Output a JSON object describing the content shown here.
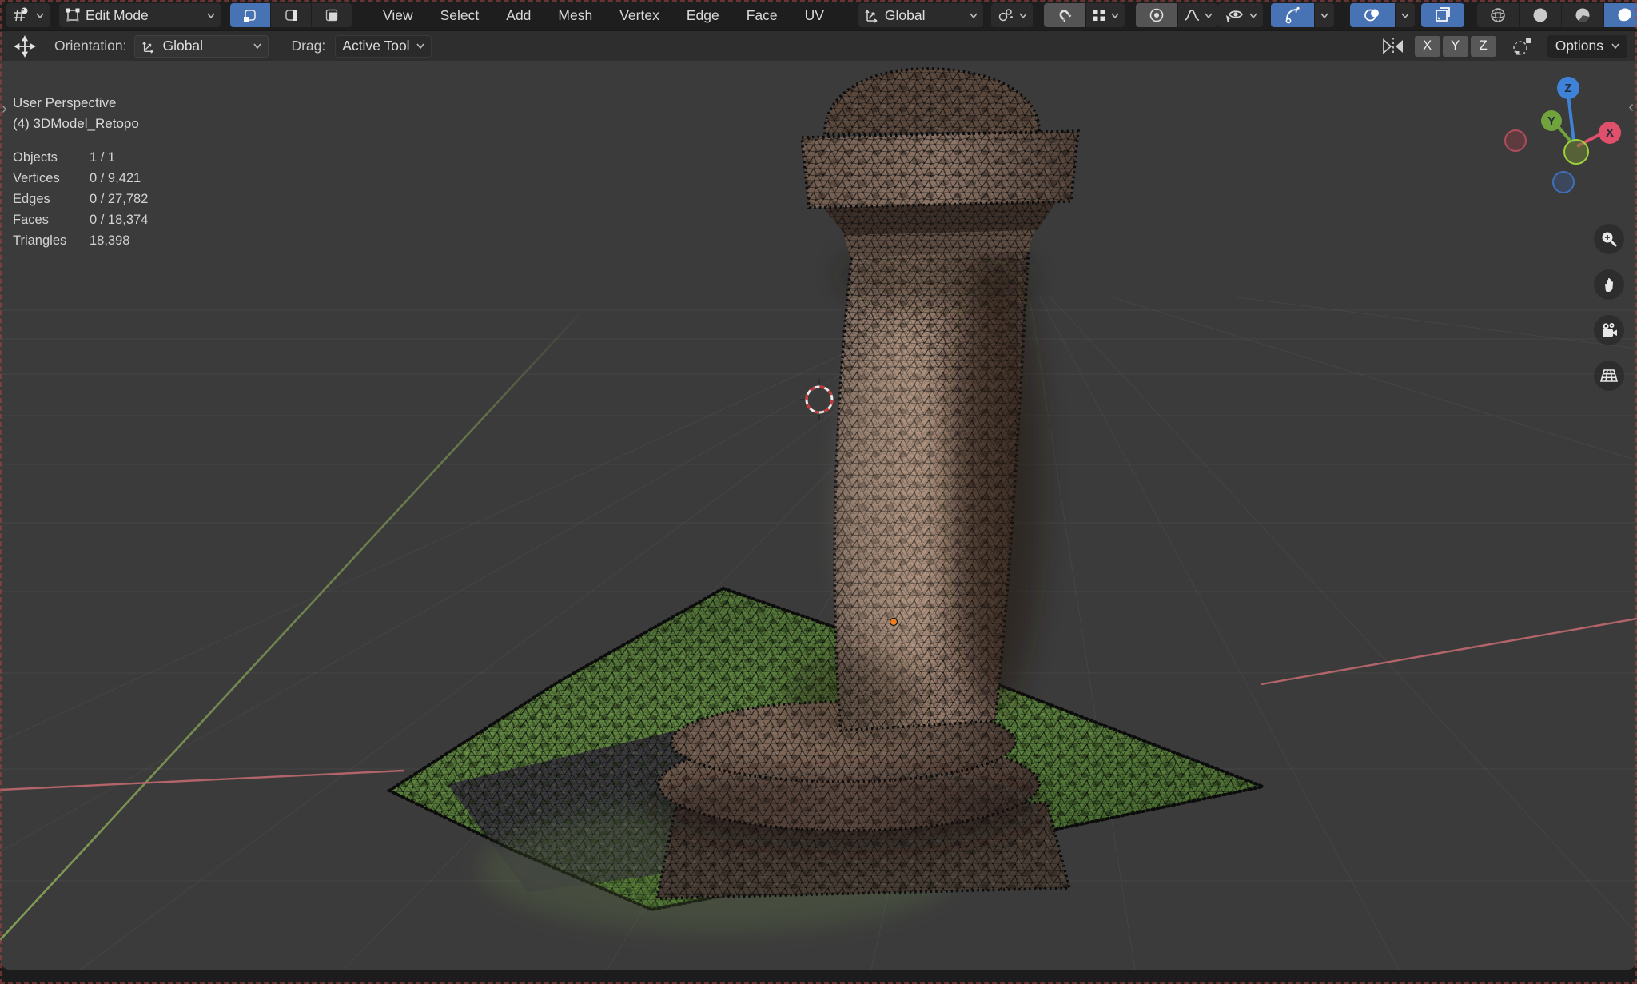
{
  "colors": {
    "accent": "#4772b3",
    "axis-x": "#c96c72",
    "axis-y": "#86a356",
    "gizmo-x": "#e0506a",
    "gizmo-y": "#71a33c",
    "gizmo-z": "#3f83d8"
  },
  "header": {
    "mode": "Edit Mode",
    "menus": [
      "View",
      "Select",
      "Add",
      "Mesh",
      "Vertex",
      "Edge",
      "Face",
      "UV"
    ],
    "orientation": "Global"
  },
  "tool_settings": {
    "orientation_label": "Orientation:",
    "orientation_value": "Global",
    "drag_label": "Drag:",
    "drag_value": "Active Tool",
    "axis_buttons": [
      "X",
      "Y",
      "Z"
    ],
    "options_label": "Options"
  },
  "viewport": {
    "overlay": {
      "title": "User Perspective",
      "object": "(4) 3DModel_Retopo",
      "stats": [
        {
          "label": "Objects",
          "value": "1 / 1"
        },
        {
          "label": "Vertices",
          "value": "0 / 9,421"
        },
        {
          "label": "Edges",
          "value": "0 / 27,782"
        },
        {
          "label": "Faces",
          "value": "0 / 18,374"
        },
        {
          "label": "Triangles",
          "value": "18,398"
        }
      ]
    },
    "gizmo_axes": {
      "x": "X",
      "y": "Y",
      "z": "Z"
    },
    "collapse_left": "›",
    "collapse_right": "‹"
  }
}
